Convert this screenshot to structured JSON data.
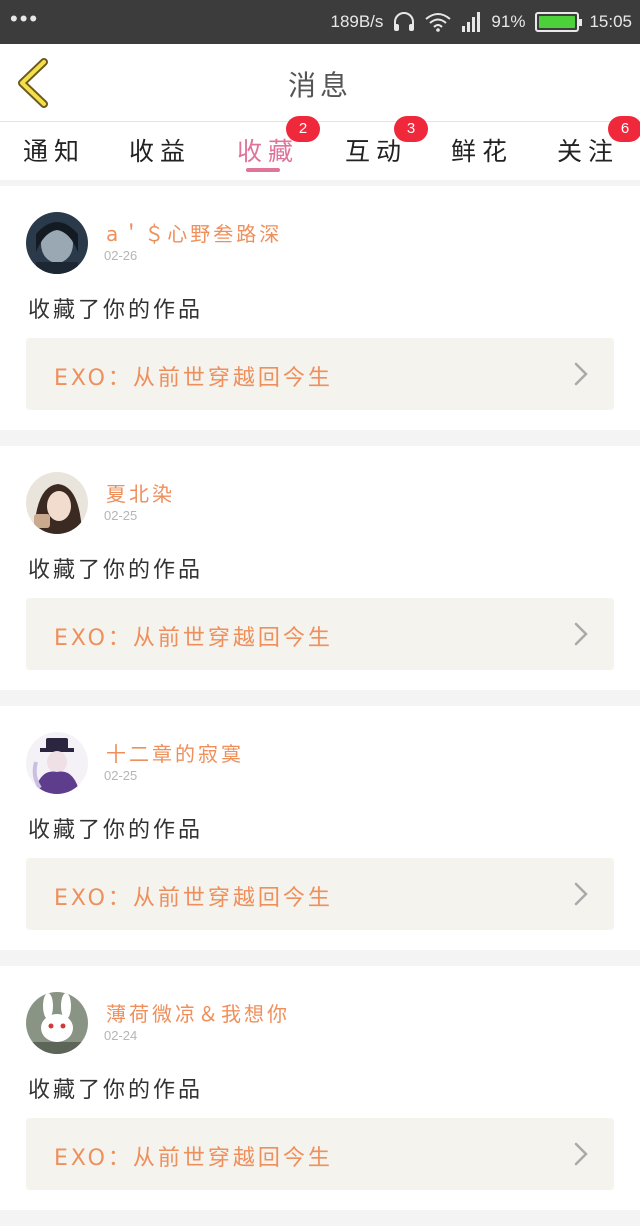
{
  "statusbar": {
    "menu": "•••",
    "speed": "189B/s",
    "battery_pct": "91%",
    "time": "15:05"
  },
  "navbar": {
    "title": "消息"
  },
  "tabs": [
    {
      "label": "通知",
      "badge": ""
    },
    {
      "label": "收益",
      "badge": ""
    },
    {
      "label": "收藏",
      "badge": "2"
    },
    {
      "label": "互动",
      "badge": "3"
    },
    {
      "label": "鲜花",
      "badge": ""
    },
    {
      "label": "关注",
      "badge": "6"
    }
  ],
  "colors": {
    "accent": "#e0739a",
    "name": "#ef8f5c",
    "badge": "#f0283c"
  },
  "items": [
    {
      "username": "a＇＄心野叁路深",
      "date": "02-26",
      "action": "收藏了你的作品",
      "work": "EXO：从前世穿越回今生"
    },
    {
      "username": "夏北染",
      "date": "02-25",
      "action": "收藏了你的作品",
      "work": "EXO：从前世穿越回今生"
    },
    {
      "username": "十二章的寂寞",
      "date": "02-25",
      "action": "收藏了你的作品",
      "work": "EXO：从前世穿越回今生"
    },
    {
      "username": "薄荷微凉＆我想你",
      "date": "02-24",
      "action": "收藏了你的作品",
      "work": "EXO：从前世穿越回今生"
    }
  ]
}
